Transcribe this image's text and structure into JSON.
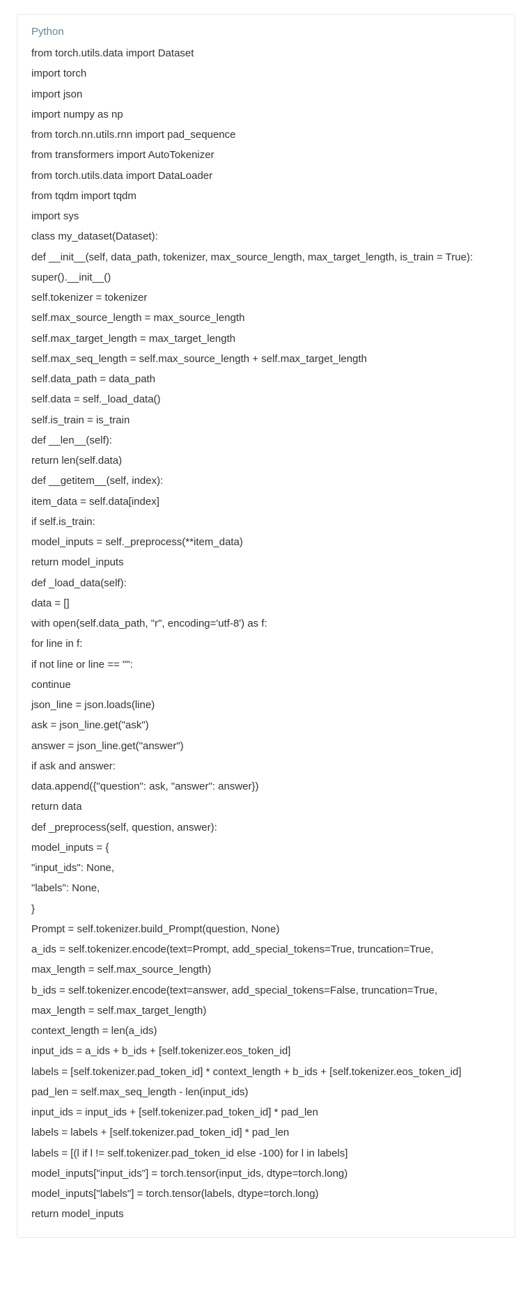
{
  "language_label": "Python",
  "code_lines": [
    "from torch.utils.data import Dataset",
    "import torch",
    "import json",
    "import numpy as np",
    "from torch.nn.utils.rnn import pad_sequence",
    "from transformers import AutoTokenizer",
    "from torch.utils.data import DataLoader",
    "from tqdm import tqdm",
    "import sys",
    "class my_dataset(Dataset):",
    "def __init__(self, data_path, tokenizer, max_source_length, max_target_length, is_train = True):",
    "super().__init__()",
    "self.tokenizer = tokenizer",
    "self.max_source_length = max_source_length",
    "self.max_target_length = max_target_length",
    "self.max_seq_length = self.max_source_length + self.max_target_length",
    "self.data_path = data_path",
    "self.data = self._load_data()",
    "self.is_train = is_train",
    "def __len__(self):",
    "return len(self.data)",
    "def __getitem__(self, index):",
    "item_data = self.data[index]",
    "if self.is_train:",
    "model_inputs = self._preprocess(**item_data)",
    "return model_inputs",
    "def _load_data(self):",
    "data = []",
    "with open(self.data_path, \"r\", encoding='utf-8') as f:",
    "for line in f:",
    "if not line or line == \"\":",
    "continue",
    "json_line = json.loads(line)",
    "ask = json_line.get(\"ask\")",
    "answer = json_line.get(\"answer\")",
    "if ask and answer:",
    "data.append({\"question\": ask, \"answer\": answer})",
    "return data",
    "def _preprocess(self, question, answer):",
    "model_inputs = {",
    "\"input_ids\": None,",
    "\"labels\": None,",
    "}",
    "Prompt = self.tokenizer.build_Prompt(question, None)",
    "a_ids = self.tokenizer.encode(text=Prompt, add_special_tokens=True, truncation=True,",
    "max_length = self.max_source_length)",
    "b_ids = self.tokenizer.encode(text=answer, add_special_tokens=False, truncation=True,",
    "max_length = self.max_target_length)",
    "context_length = len(a_ids)",
    "input_ids = a_ids + b_ids + [self.tokenizer.eos_token_id]",
    "labels = [self.tokenizer.pad_token_id] * context_length + b_ids + [self.tokenizer.eos_token_id]",
    "pad_len = self.max_seq_length - len(input_ids)",
    "input_ids = input_ids + [self.tokenizer.pad_token_id] * pad_len",
    "labels = labels + [self.tokenizer.pad_token_id] * pad_len",
    "labels = [(l if l != self.tokenizer.pad_token_id else -100) for l in labels]",
    "model_inputs[\"input_ids\"] = torch.tensor(input_ids, dtype=torch.long)",
    "model_inputs[\"labels\"] = torch.tensor(labels, dtype=torch.long)",
    "return model_inputs"
  ]
}
